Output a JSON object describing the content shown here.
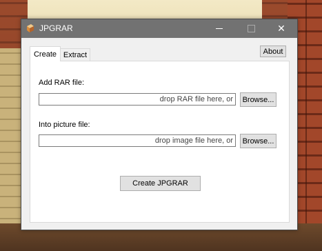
{
  "window": {
    "title": "JPGRAR",
    "close_glyph": "✕"
  },
  "about_label": "About",
  "tabs": [
    {
      "label": "Create",
      "active": true
    },
    {
      "label": "Extract",
      "active": false
    }
  ],
  "create": {
    "rar_label": "Add RAR file:",
    "rar_placeholder": "drop RAR file here, or",
    "rar_browse": "Browse...",
    "image_label": "Into picture file:",
    "image_placeholder": "drop image file here, or",
    "image_browse": "Browse...",
    "create_button": "Create JPGRAR"
  },
  "colors": {
    "titlebar": "#727272",
    "window_bg": "#f0f0f0",
    "button_bg": "#e1e1e1"
  },
  "icons": [
    "app-icon",
    "minimize-icon",
    "maximize-icon",
    "close-icon"
  ]
}
